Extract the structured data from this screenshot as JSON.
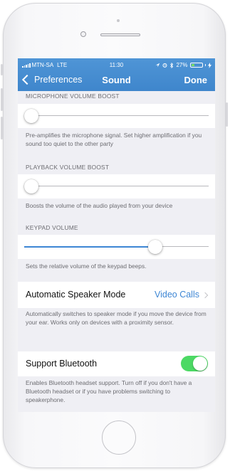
{
  "status_bar": {
    "carrier": "MTN-SA",
    "network": "LTE",
    "time": "11:30",
    "battery": "27%",
    "battery_level": 0.27,
    "icons": [
      "location-arrow-icon",
      "alarm-icon",
      "bluetooth-icon"
    ]
  },
  "nav": {
    "back_label": "Preferences",
    "title": "Sound",
    "done_label": "Done"
  },
  "sections": {
    "mic": {
      "header": "MICROPHONE VOLUME BOOST",
      "value": 0,
      "footer": "Pre-amplifies the microphone signal. Set higher amplification if you sound too quiet to the other party"
    },
    "playback": {
      "header": "PLAYBACK VOLUME BOOST",
      "value": 0,
      "footer": "Boosts the volume of the audio played from your device"
    },
    "keypad": {
      "header": "KEYPAD VOLUME",
      "value": 0.71,
      "footer": "Sets the relative volume of the keypad beeps."
    },
    "speaker_mode": {
      "label": "Automatic Speaker Mode",
      "value": "Video Calls",
      "footer": "Automatically switches to speaker mode if you move the device from your ear. Works only on devices with a proximity sensor."
    },
    "bluetooth": {
      "label": "Support Bluetooth",
      "enabled": true,
      "footer": "Enables Bluetooth headset support. Turn off if you don't have a Bluetooth headset or if you have problems switching to speakerphone."
    }
  },
  "colors": {
    "accent": "#3d86d4",
    "header": "#4a90d9",
    "switch_on": "#4cd964",
    "background": "#efeff4"
  }
}
